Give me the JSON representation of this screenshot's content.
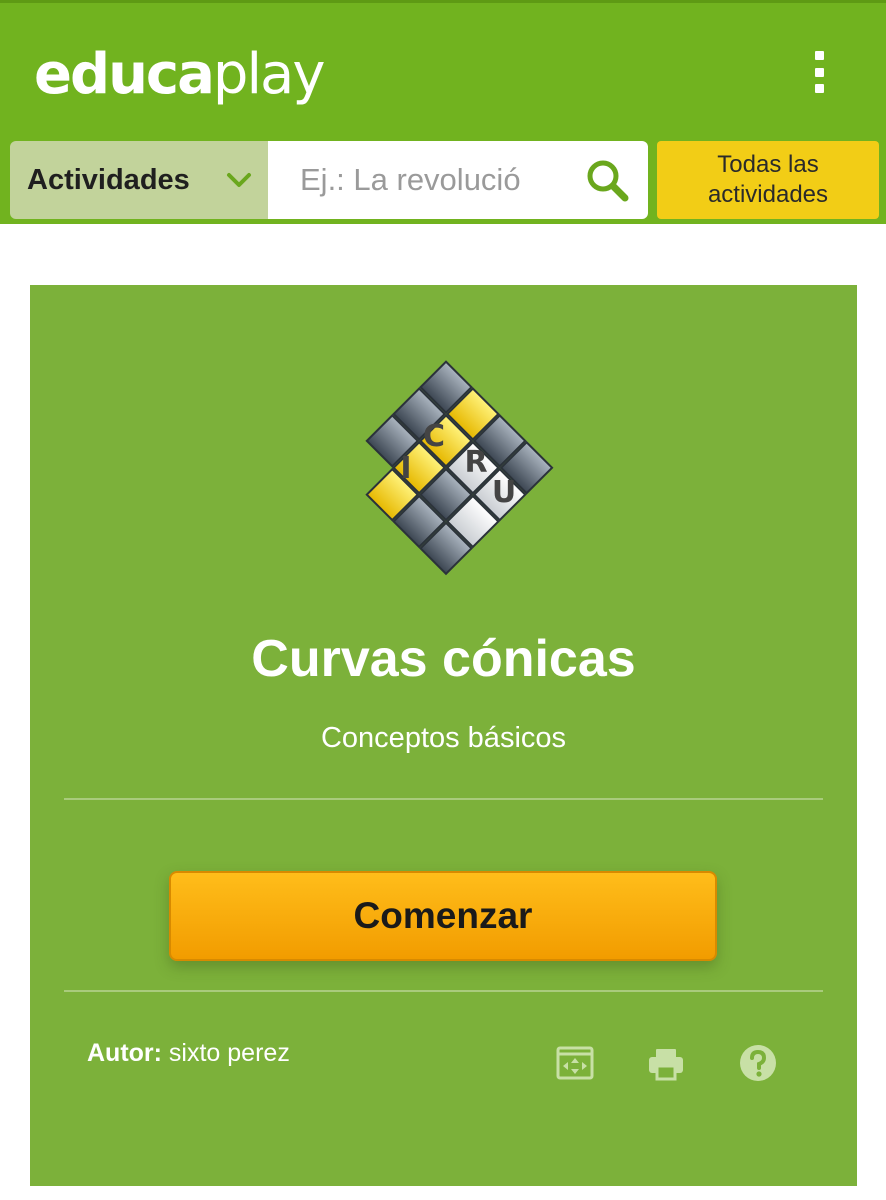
{
  "header": {
    "logo_bold": "educa",
    "logo_light": "play",
    "menu_icon": "kebab-menu-icon",
    "colors": {
      "bar": "#71b31f",
      "accent_yellow": "#f2cd16"
    }
  },
  "search": {
    "category_label": "Actividades",
    "placeholder": "Ej.: La revolució",
    "value": "",
    "all_activities_label": "Todas las actividades"
  },
  "activity": {
    "title": "Curvas cónicas",
    "subtitle": "Conceptos básicos",
    "start_label": "Comenzar",
    "author_key": "Autor:",
    "author_name": " sixto perez",
    "logo_letters": [
      "C",
      "R",
      "U",
      "I"
    ],
    "icons": [
      "fullscreen-icon",
      "print-icon",
      "help-icon"
    ],
    "colors": {
      "card": "#7cb13a",
      "start": "#f7a70c"
    }
  }
}
